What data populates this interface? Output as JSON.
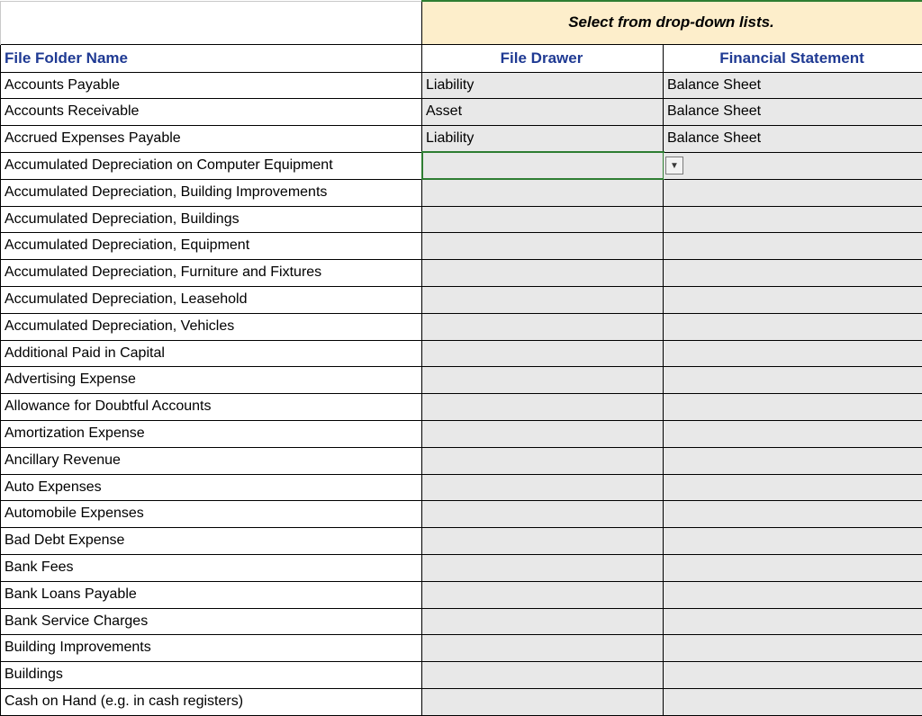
{
  "banner": "Select from drop-down lists.",
  "headers": {
    "name": "File Folder Name",
    "drawer": "File Drawer",
    "statement": "Financial Statement"
  },
  "rows": [
    {
      "name": "Accounts Payable",
      "drawer": "Liability",
      "statement": "Balance Sheet",
      "active": false
    },
    {
      "name": "Accounts Receivable",
      "drawer": "Asset",
      "statement": "Balance Sheet",
      "active": false
    },
    {
      "name": "Accrued Expenses Payable",
      "drawer": "Liability",
      "statement": "Balance Sheet",
      "active": false
    },
    {
      "name": "Accumulated Depreciation on Computer Equipment",
      "drawer": "",
      "statement": "",
      "active": true
    },
    {
      "name": "Accumulated Depreciation, Building Improvements",
      "drawer": "",
      "statement": "",
      "active": false
    },
    {
      "name": "Accumulated Depreciation, Buildings",
      "drawer": "",
      "statement": "",
      "active": false
    },
    {
      "name": "Accumulated Depreciation, Equipment",
      "drawer": "",
      "statement": "",
      "active": false
    },
    {
      "name": "Accumulated Depreciation, Furniture and Fixtures",
      "drawer": "",
      "statement": "",
      "active": false
    },
    {
      "name": "Accumulated Depreciation, Leasehold",
      "drawer": "",
      "statement": "",
      "active": false
    },
    {
      "name": "Accumulated Depreciation, Vehicles",
      "drawer": "",
      "statement": "",
      "active": false
    },
    {
      "name": "Additional Paid in Capital",
      "drawer": "",
      "statement": "",
      "active": false
    },
    {
      "name": "Advertising Expense",
      "drawer": "",
      "statement": "",
      "active": false
    },
    {
      "name": "Allowance for Doubtful Accounts",
      "drawer": "",
      "statement": "",
      "active": false
    },
    {
      "name": "Amortization Expense",
      "drawer": "",
      "statement": "",
      "active": false
    },
    {
      "name": "Ancillary Revenue",
      "drawer": "",
      "statement": "",
      "active": false
    },
    {
      "name": "Auto Expenses",
      "drawer": "",
      "statement": "",
      "active": false
    },
    {
      "name": "Automobile Expenses",
      "drawer": "",
      "statement": "",
      "active": false
    },
    {
      "name": "Bad Debt Expense",
      "drawer": "",
      "statement": "",
      "active": false
    },
    {
      "name": "Bank Fees",
      "drawer": "",
      "statement": "",
      "active": false
    },
    {
      "name": "Bank Loans Payable",
      "drawer": "",
      "statement": "",
      "active": false
    },
    {
      "name": "Bank Service Charges",
      "drawer": "",
      "statement": "",
      "active": false
    },
    {
      "name": "Building Improvements",
      "drawer": "",
      "statement": "",
      "active": false
    },
    {
      "name": "Buildings",
      "drawer": "",
      "statement": "",
      "active": false
    },
    {
      "name": "Cash on Hand (e.g. in cash registers)",
      "drawer": "",
      "statement": "",
      "active": false
    }
  ]
}
